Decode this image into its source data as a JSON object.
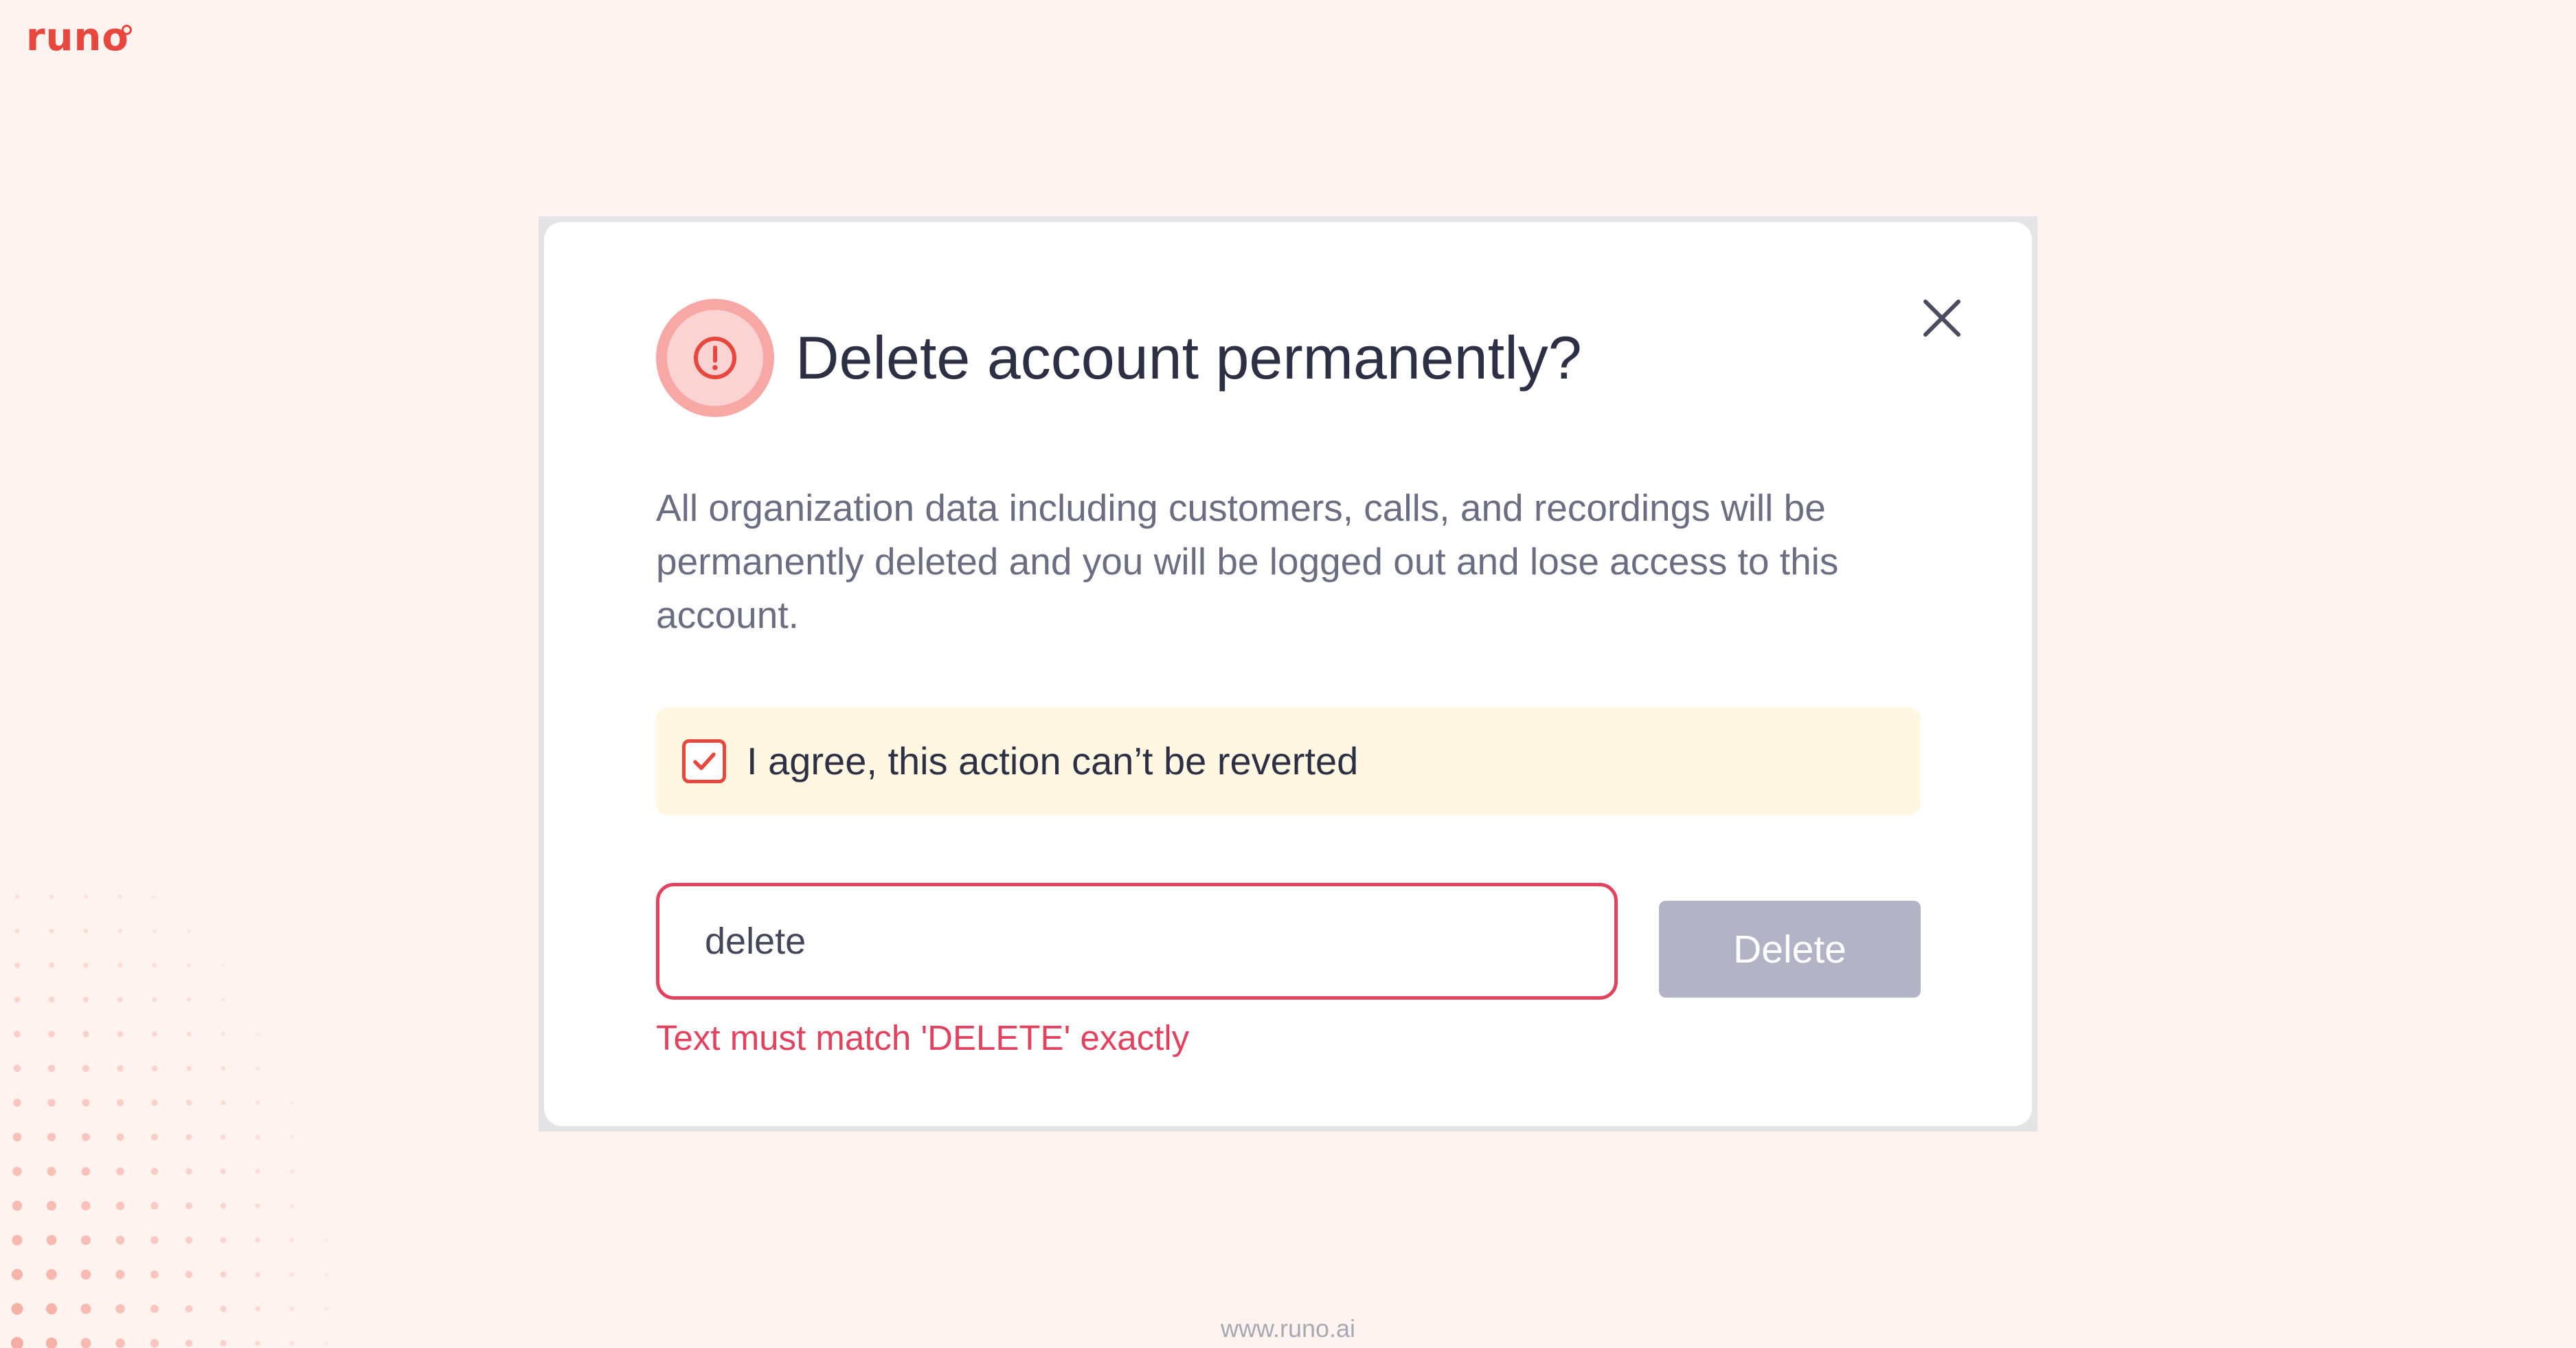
{
  "brand": {
    "logo_text": "runo",
    "accent_color": "#e8473e"
  },
  "dialog": {
    "title": "Delete account permanently?",
    "warning_icon": "exclamation-circle-icon",
    "close_icon": "close-icon",
    "description": "All organization data including customers, calls, and recordings will be permanently deleted and you will be logged out and lose access to this account.",
    "agreement": {
      "label": "I agree, this action can’t be reverted",
      "checked": true
    },
    "confirm_input": {
      "value": "delete"
    },
    "delete_button_label": "Delete",
    "error_message": "Text must match 'DELETE' exactly",
    "error_color": "#e3425f"
  },
  "footer": {
    "url": "www.runo.ai"
  }
}
